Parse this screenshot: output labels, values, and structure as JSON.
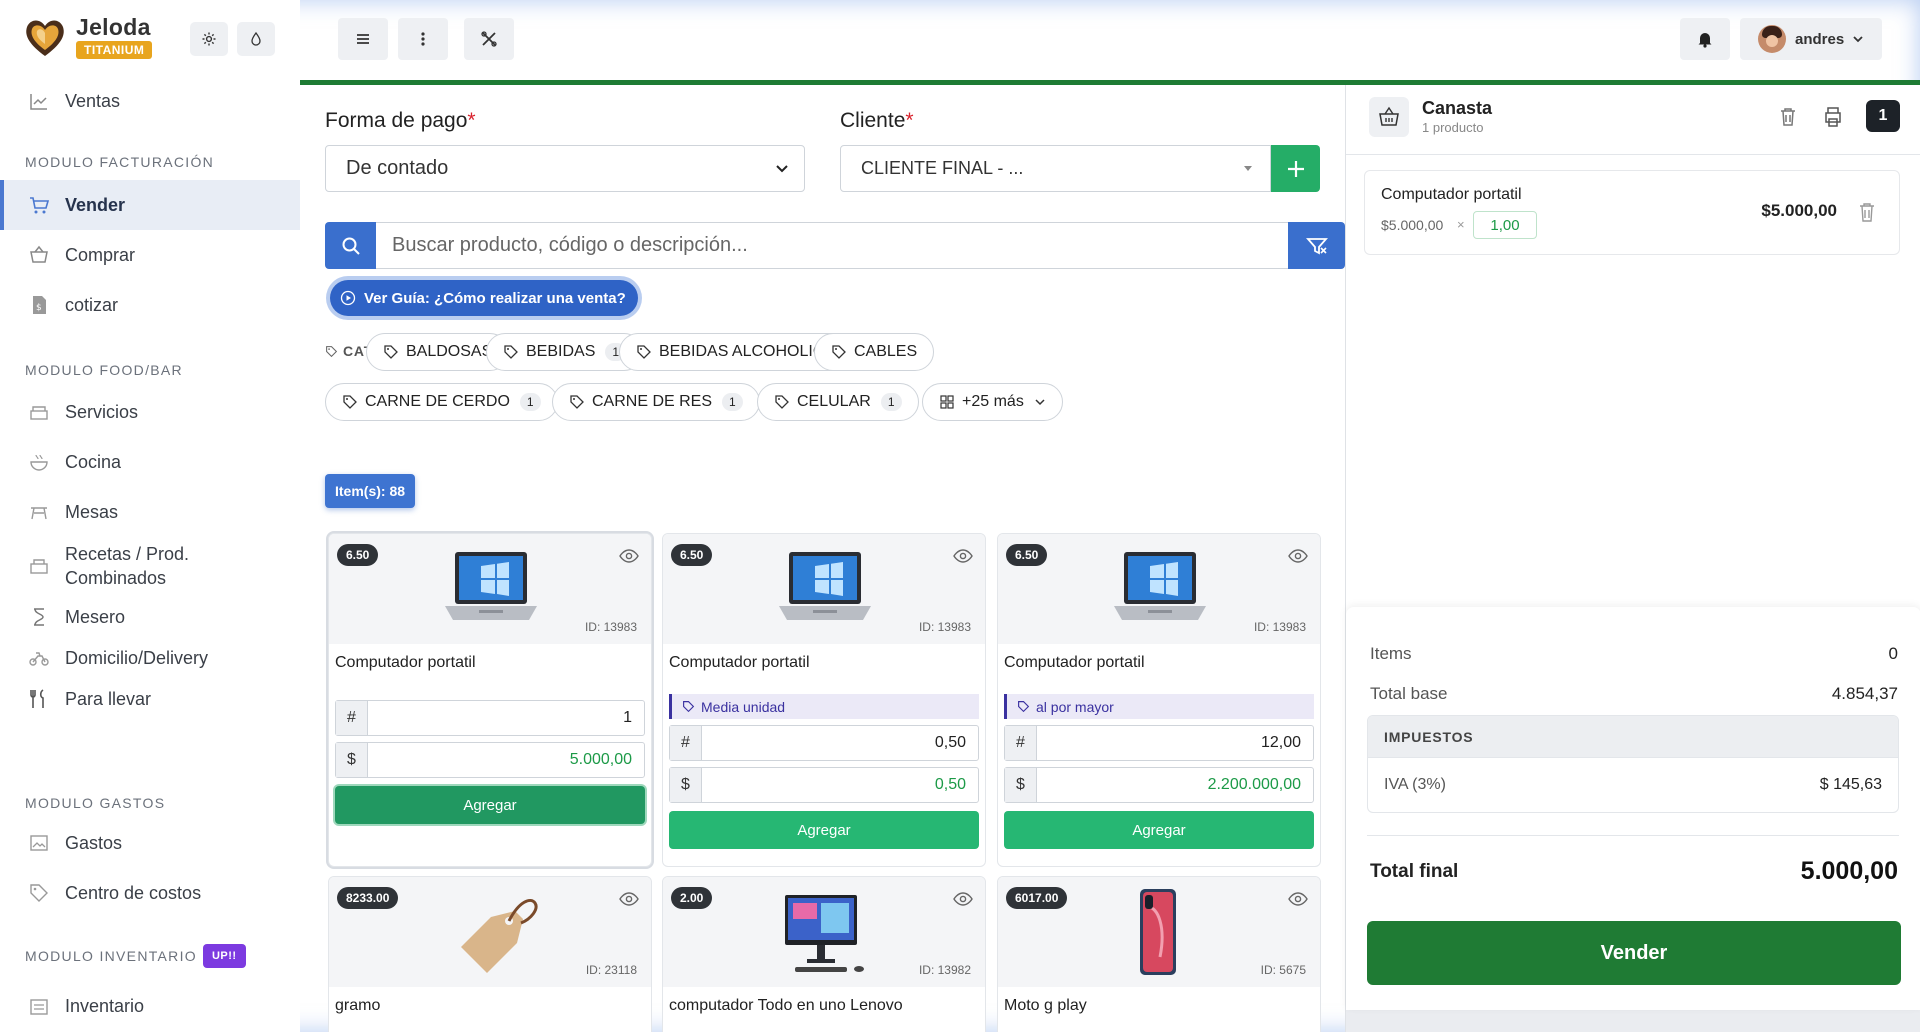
{
  "brand": {
    "name": "Jeloda",
    "badge": "TITANIUM"
  },
  "sidebar": {
    "top_item": "Ventas",
    "sections": [
      {
        "title": "MODULO FACTURACIÓN",
        "items": [
          "Vender",
          "Comprar",
          "cotizar"
        ]
      },
      {
        "title": "MODULO FOOD/BAR",
        "items": [
          "Servicios",
          "Cocina",
          "Mesas",
          "Recetas / Prod. Combinados",
          "Mesero",
          "Domicilio/Delivery",
          "Para llevar"
        ]
      },
      {
        "title": "MODULO GASTOS",
        "items": [
          "Gastos",
          "Centro de costos"
        ]
      },
      {
        "title": "MODULO INVENTARIO",
        "badge": "UP!!",
        "items": [
          "Inventario"
        ]
      }
    ],
    "recetas_line1": "Recetas / Prod.",
    "recetas_line2": "Combinados",
    "active_item": "Vender"
  },
  "topbar": {
    "user": "andres"
  },
  "form": {
    "payment_label": "Forma de pago",
    "payment_value": "De contado",
    "client_label": "Cliente",
    "client_value": "CLIENTE FINAL - ...",
    "required_mark": "*"
  },
  "search": {
    "placeholder": "Buscar producto, código o descripción..."
  },
  "guide": {
    "label": "Ver Guía: ¿Cómo realizar una venta?"
  },
  "categories": {
    "label": "CATEGORÍAS",
    "chips": [
      {
        "name": "BALDOSAS",
        "count": ""
      },
      {
        "name": "BEBIDAS",
        "count": "1"
      },
      {
        "name": "BEBIDAS ALCOHOLICAS",
        "count": ""
      },
      {
        "name": "CABLES",
        "count": ""
      },
      {
        "name": "CARNE DE CERDO",
        "count": "1"
      },
      {
        "name": "CARNE DE RES",
        "count": "1"
      },
      {
        "name": "CELULAR",
        "count": "1"
      }
    ],
    "more": "+25 más"
  },
  "items_count": "Item(s): 88",
  "products": [
    {
      "price": "6.50",
      "id": "ID: 13983",
      "title": "Computador portatil",
      "tier": "",
      "qty": "1",
      "amount": "5.000,00",
      "button": "Agregar"
    },
    {
      "price": "6.50",
      "id": "ID: 13983",
      "title": "Computador portatil",
      "tier": "Media unidad",
      "qty": "0,50",
      "amount": "0,50",
      "button": "Agregar"
    },
    {
      "price": "6.50",
      "id": "ID: 13983",
      "title": "Computador portatil",
      "tier": "al por mayor",
      "qty": "12,00",
      "amount": "2.200.000,00",
      "button": "Agregar"
    },
    {
      "price": "8233.00",
      "id": "ID: 23118",
      "title": "gramo"
    },
    {
      "price": "2.00",
      "id": "ID: 13982",
      "title": "computador Todo en uno Lenovo"
    },
    {
      "price": "6017.00",
      "id": "ID: 5675",
      "title": "Moto g play"
    }
  ],
  "prefix": {
    "qty": "#",
    "money": "$"
  },
  "basket": {
    "title": "Canasta",
    "subtitle": "1 producto",
    "count": "1",
    "line": {
      "name": "Computador portatil",
      "unit_price": "$5.000,00",
      "times": "×",
      "qty": "1,00",
      "total": "$5.000,00"
    }
  },
  "summary": {
    "items_label": "Items",
    "items_value": "0",
    "base_label": "Total base",
    "base_value": "4.854,37",
    "taxes_title": "IMPUESTOS",
    "iva_label": "IVA (3%)",
    "iva_value": "$ 145,63",
    "final_label": "Total final",
    "final_value": "5.000,00",
    "sell_button": "Vender"
  },
  "colors": {
    "accent": "#3a6fcd",
    "success": "#26b773",
    "dark_green": "#1f7b34",
    "brand_gold": "#e8a51e"
  }
}
